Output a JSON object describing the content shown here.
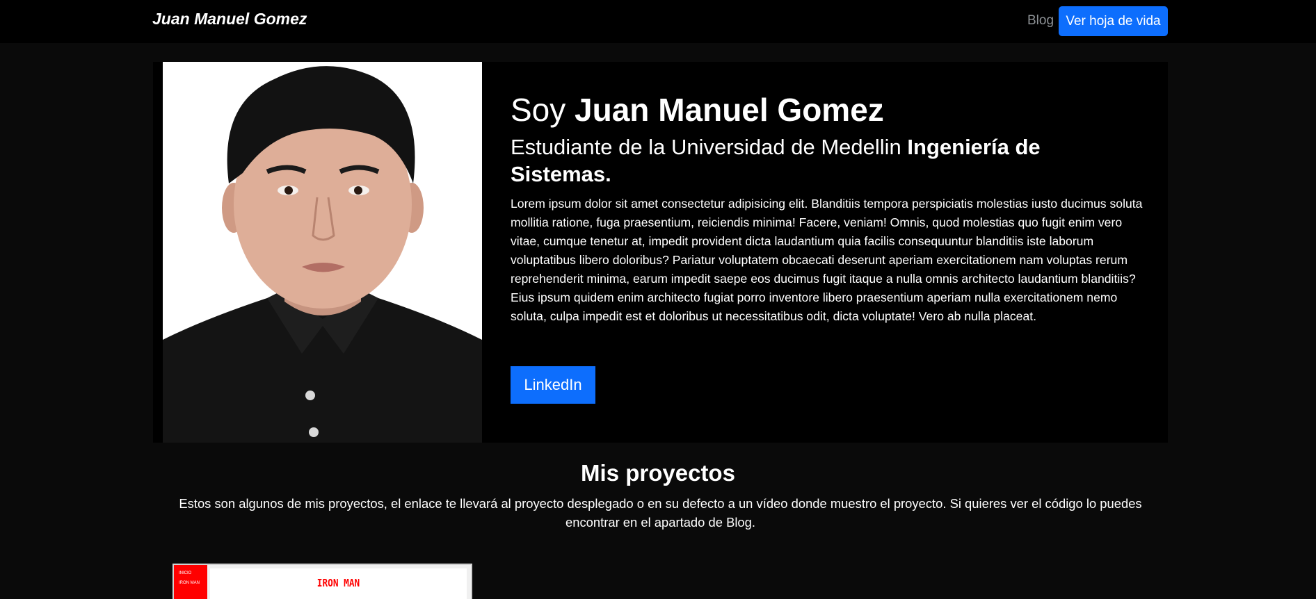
{
  "navbar": {
    "brand": "Juan Manuel Gomez",
    "blog_link": "Blog",
    "cv_button": "Ver hoja de vida"
  },
  "hero": {
    "title_prefix": "Soy ",
    "title_name": "Juan Manuel Gomez",
    "subtitle_prefix": "Estudiante de la Universidad de Medellin ",
    "subtitle_bold": "Ingeniería de Sistemas.",
    "description": "Lorem ipsum dolor sit amet consectetur adipisicing elit. Blanditiis tempora perspiciatis molestias iusto ducimus soluta mollitia ratione, fuga praesentium, reiciendis minima! Facere, veniam! Omnis, quod molestias quo fugit enim vero vitae, cumque tenetur at, impedit provident dicta laudantium quia facilis consequuntur blanditiis iste laborum voluptatibus libero doloribus? Pariatur voluptatem obcaecati deserunt aperiam exercitationem nam voluptas rerum reprehenderit minima, earum impedit saepe eos ducimus fugit itaque a nulla omnis architecto laudantium blanditiis? Eius ipsum quidem enim architecto fugiat porro inventore libero praesentium aperiam nulla exercitationem nemo soluta, culpa impedit est et doloribus ut necessitatibus odit, dicta voluptate! Vero ab nulla placeat.",
    "linkedin_button": "LinkedIn"
  },
  "projects": {
    "title": "Mis proyectos",
    "description": "Estos son algunos de mis proyectos, el enlace te llevará al proyecto desplegado o en su defecto a un vídeo donde muestro el proyecto. Si quieres ver el código lo puedes encontrar en el apartado de Blog.",
    "cards": [
      {
        "title": "IRON MAN",
        "side_items": [
          "INICIO",
          "IRON MAN"
        ]
      }
    ]
  },
  "colors": {
    "accent": "#0d6efd",
    "nav_bg": "#000000",
    "page_bg": "#0a0a0a",
    "card_accent": "#ff0000"
  }
}
